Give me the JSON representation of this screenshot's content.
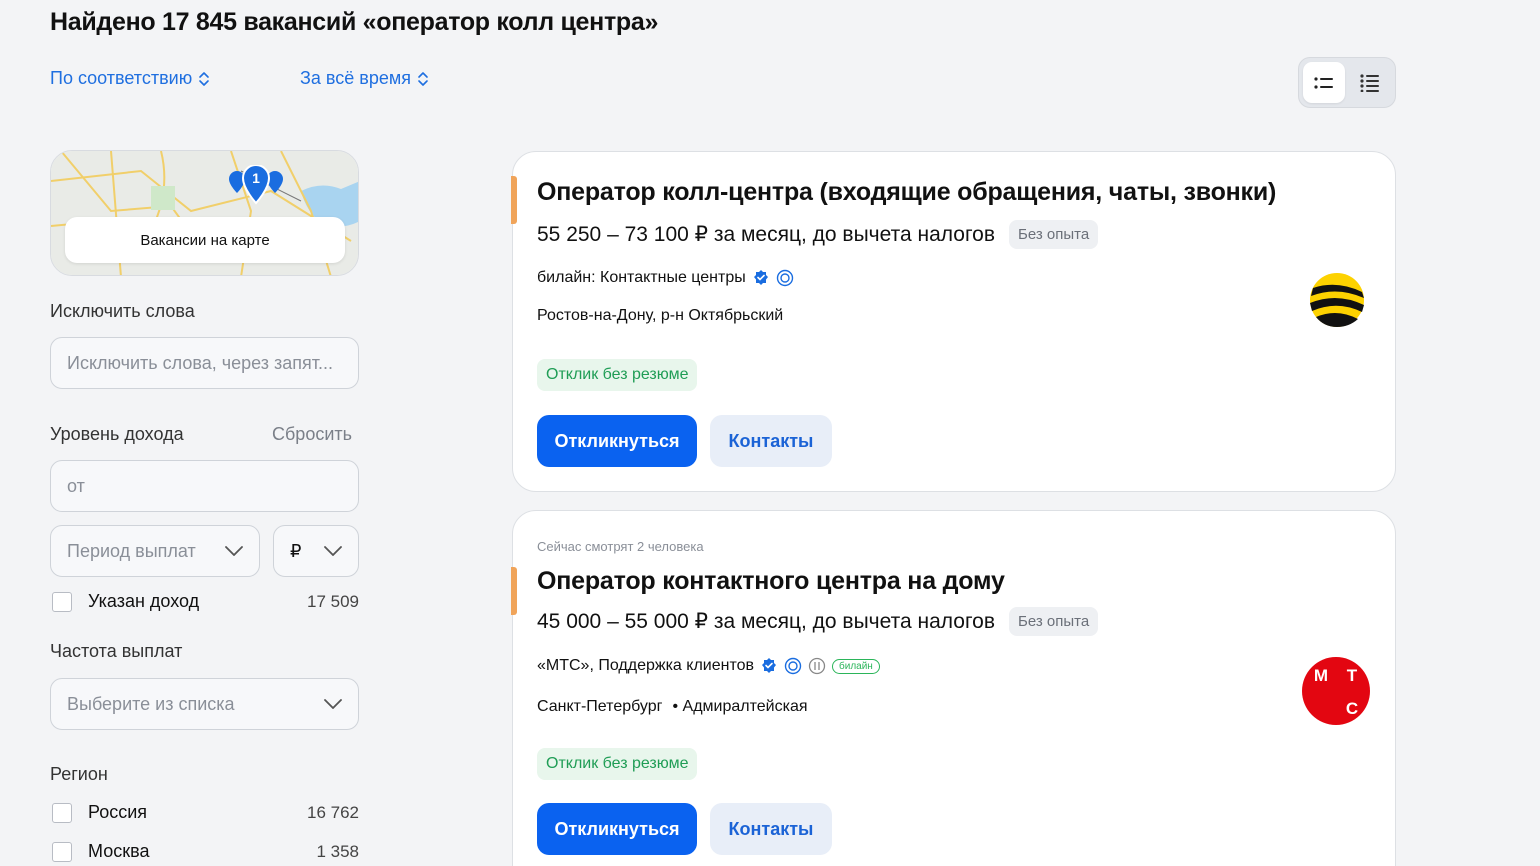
{
  "header": {
    "title": "Найдено 17 845 вакансий «оператор колл центра»",
    "sort_relevance": "По соответствию",
    "sort_period": "За всё время"
  },
  "sidebar": {
    "map_label": "Вакансии на карте",
    "map_pin_count": "1",
    "exclude_label": "Исключить слова",
    "exclude_placeholder": "Исключить слова, через запят...",
    "income_label": "Уровень дохода",
    "income_reset": "Сбросить",
    "income_from_placeholder": "от",
    "period_placeholder": "Период выплат",
    "currency": "₽",
    "income_specified_label": "Указан доход",
    "income_specified_count": "17 509",
    "frequency_label": "Частота выплат",
    "frequency_placeholder": "Выберите из списка",
    "region_label": "Регион",
    "regions": [
      {
        "name": "Россия",
        "count": "16 762"
      },
      {
        "name": "Москва",
        "count": "1 358"
      }
    ]
  },
  "vacancies": [
    {
      "title": "Оператор колл-центра (входящие обращения, чаты, звонки)",
      "salary": "55 250 – 73 100 ₽ за месяц, до вычета налогов",
      "experience": "Без опыта",
      "company": "билайн: Контактные центры",
      "location": "Ростов-на-Дону, р-н Октябрьский",
      "metro": "",
      "feature": "Отклик без резюме",
      "apply_label": "Откликнуться",
      "contacts_label": "Контакты",
      "viewing": ""
    },
    {
      "title": "Оператор контактного центра на дому",
      "salary": "45 000 – 55 000 ₽ за месяц, до вычета налогов",
      "experience": "Без опыта",
      "company": "«МТС», Поддержка клиентов",
      "company_badge": "билайн",
      "location": "Санкт-Петербург",
      "metro": "• Адмиралтейская",
      "feature": "Отклик без резюме",
      "apply_label": "Откликнуться",
      "contacts_label": "Контакты",
      "viewing": "Сейчас смотрят 2 человека",
      "logo_letters": [
        "М",
        "Т",
        "С"
      ]
    }
  ],
  "colors": {
    "accent_blue": "#0a62f0",
    "link_blue": "#1f6fe0",
    "accent_orange": "#f0a45a",
    "success_green": "#1f9d55",
    "mts_red": "#e30611",
    "beeline_yellow": "#fdd200"
  }
}
